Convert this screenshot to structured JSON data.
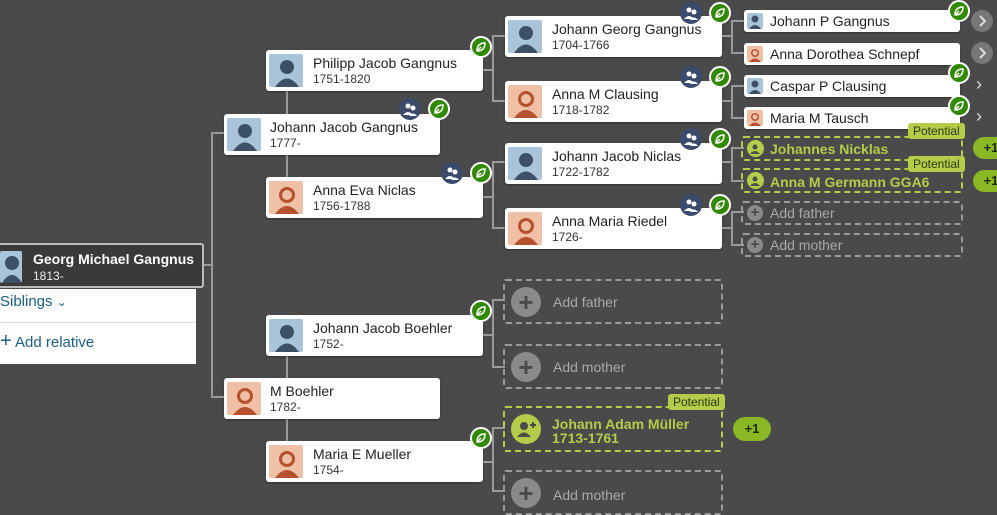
{
  "focus_person": {
    "name": "Georg Michael Gangnus",
    "years": "1813-"
  },
  "menu": {
    "siblings_label": "Siblings",
    "add_relative_label": "Add relative"
  },
  "people": {
    "johann_jacob_gangnus": {
      "name": "Johann Jacob Gangnus",
      "years": "1777-"
    },
    "m_boehler": {
      "name": "M Boehler",
      "years": "1782-"
    },
    "philipp_jacob_gangnus": {
      "name": "Philipp Jacob Gangnus",
      "years": "1751-1820"
    },
    "anna_eva_niclas": {
      "name": "Anna Eva Niclas",
      "years": "1756-1788"
    },
    "johann_jacob_boehler": {
      "name": "Johann Jacob Boehler",
      "years": "1752-"
    },
    "maria_e_mueller": {
      "name": "Maria E Mueller",
      "years": "1754-"
    },
    "johann_georg_gangnus": {
      "name": "Johann Georg Gangnus",
      "years": "1704-1766"
    },
    "anna_m_clausing": {
      "name": "Anna M Clausing",
      "years": "1718-1782"
    },
    "johann_jacob_niclas": {
      "name": "Johann Jacob Niclas",
      "years": "1722-1782"
    },
    "anna_maria_riedel": {
      "name": "Anna Maria Riedel",
      "years": "1726-"
    },
    "johann_p_gangnus": {
      "name": "Johann P Gangnus"
    },
    "anna_dorothea_schnepf": {
      "name": "Anna Dorothea Schnepf"
    },
    "caspar_p_clausing": {
      "name": "Caspar P Clausing"
    },
    "maria_m_tausch": {
      "name": "Maria M Tausch"
    }
  },
  "potential": {
    "tag": "Potential",
    "johannes_nicklas": "Johannes Nicklas",
    "anna_m_germann": "Anna M Germann GGA6",
    "johann_adam_muller": "Johann Adam Müller",
    "johann_adam_muller_years": "1713-1761",
    "count": "+1"
  },
  "placeholders": {
    "add_father": "Add father",
    "add_mother": "Add mother"
  },
  "colors": {
    "background": "#4a4a4a",
    "hint_green": "#2f8a00",
    "potential_green": "#b4cc4a",
    "link_blue": "#1a5e83"
  },
  "icons": [
    "male-avatar-icon",
    "female-avatar-icon",
    "hint-leaf-icon",
    "people-group-icon",
    "plus-icon",
    "chevron-right-icon",
    "chevron-down-icon",
    "add-person-icon"
  ]
}
